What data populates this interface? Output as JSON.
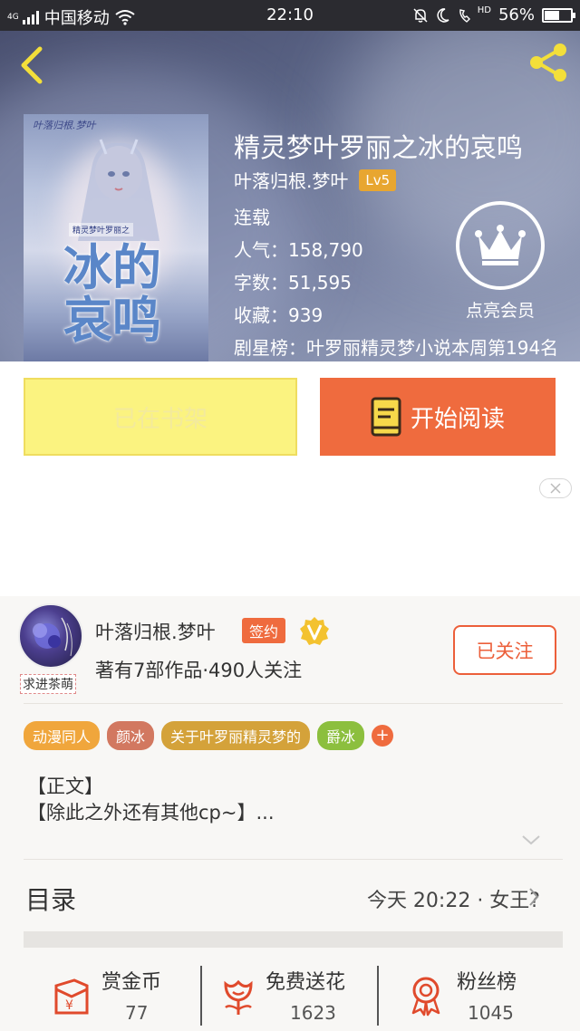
{
  "status_bar": {
    "network_small": "4G",
    "carrier": "中国移动",
    "time": "22:10",
    "hd_label": "HD",
    "battery": "56%",
    "battery_level": 0.56
  },
  "header": {
    "back_icon": "chevron-left-icon",
    "share_icon": "share-icon",
    "cover": {
      "author_text": "叶落归根.梦叶",
      "subtitle_text": "精灵梦叶罗丽之",
      "title_text": "冰的哀鸣"
    },
    "title": "精灵梦叶罗丽之冰的哀鸣",
    "author": "叶落归根.梦叶",
    "level": "Lv5",
    "status": "连载",
    "popularity": "人气：158,790",
    "word_count": "字数：51,595",
    "favorites": "收藏：939",
    "ranking": "剧星榜：叶罗丽精灵梦小说本周第194名",
    "vip_label": "点亮会员"
  },
  "actions": {
    "shelf_label": "已在书架",
    "read_label": "开始阅读"
  },
  "author_card": {
    "avatar_caption": "求进茶萌",
    "name": "叶落归根.梦叶",
    "sign_badge": "签约",
    "stats": "著有7部作品·490人关注",
    "follow_label": "已关注"
  },
  "tags": [
    {
      "label": "动漫同人",
      "color": "#f0a63c"
    },
    {
      "label": "颜冰",
      "color": "#d27860"
    },
    {
      "label": "关于叶罗丽精灵梦的",
      "color": "#d4a23a"
    },
    {
      "label": "爵冰",
      "color": "#8cbf3e"
    }
  ],
  "description": {
    "line1": "【正文】",
    "line2": "【除此之外还有其他cp~】..."
  },
  "toc": {
    "label": "目录",
    "latest": "今天 20:22 · 女王?"
  },
  "bottom": {
    "reward_label": "赏金币",
    "reward_count": "77",
    "flower_label": "免费送花",
    "flower_count": "1623",
    "fans_label": "粉丝榜",
    "fans_count": "1045"
  },
  "colors": {
    "accent": "#ef6b3e",
    "shelf_yellow": "#fbf380",
    "level_badge": "#e8a630"
  }
}
